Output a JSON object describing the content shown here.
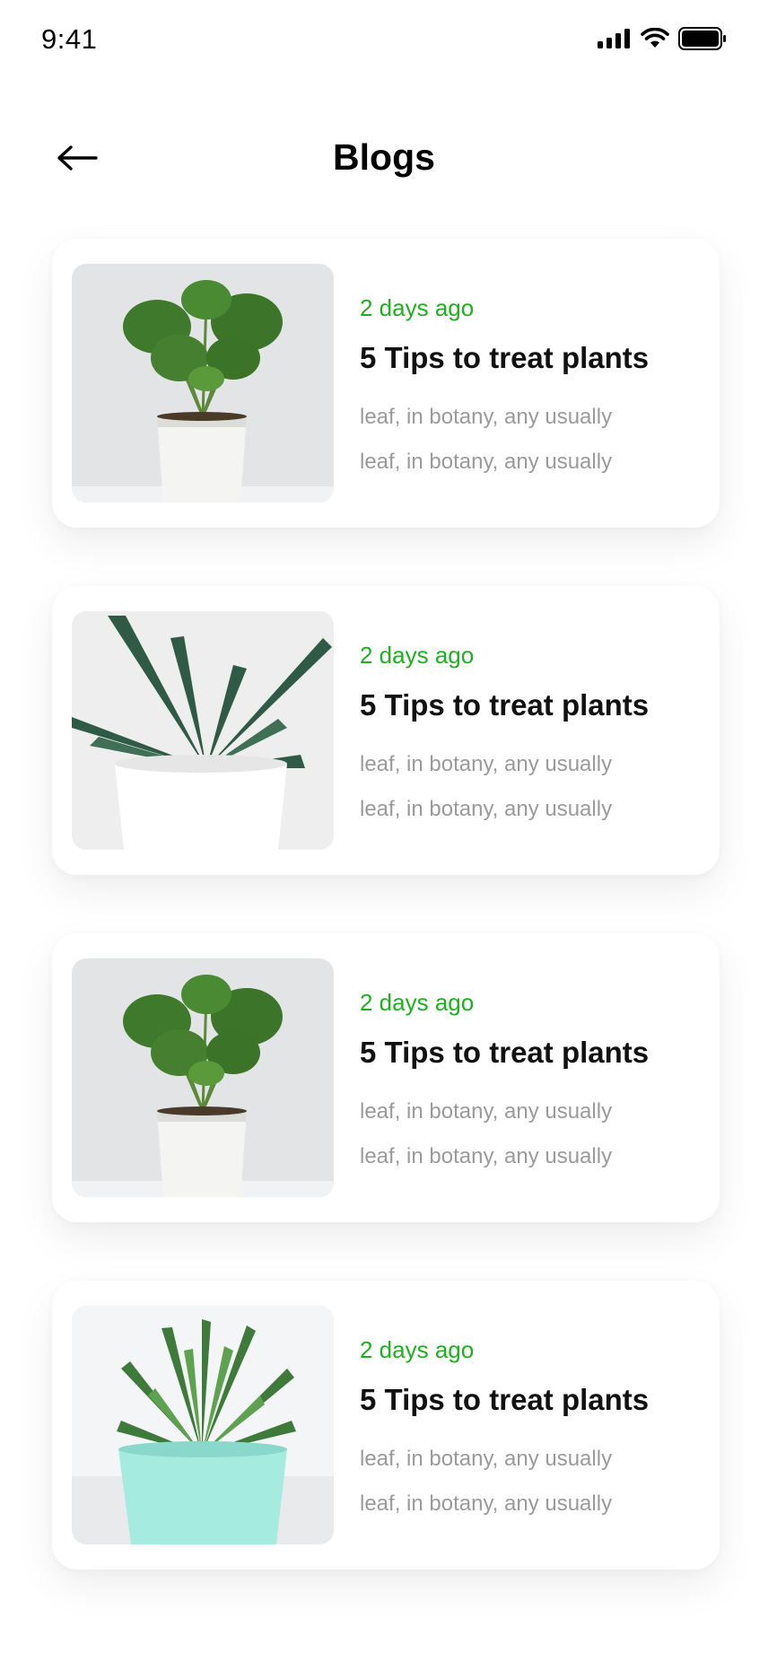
{
  "status_bar": {
    "time": "9:41"
  },
  "header": {
    "title": "Blogs"
  },
  "posts": [
    {
      "date": "2 days ago",
      "title": "5 Tips to treat plants",
      "excerpt_line1": "leaf, in botany, any usually",
      "excerpt_line2": "leaf, in botany, any usually"
    },
    {
      "date": "2 days ago",
      "title": "5 Tips to treat plants",
      "excerpt_line1": "leaf, in botany, any usually",
      "excerpt_line2": "leaf, in botany, any usually"
    },
    {
      "date": "2 days ago",
      "title": "5 Tips to treat plants",
      "excerpt_line1": "leaf, in botany, any usually",
      "excerpt_line2": "leaf, in botany, any usually"
    },
    {
      "date": "2 days ago",
      "title": "5 Tips to treat plants",
      "excerpt_line1": "leaf, in botany, any usually",
      "excerpt_line2": "leaf, in botany, any usually"
    }
  ],
  "icons": {
    "back": "arrow-left-icon",
    "signal": "cellular-signal-icon",
    "wifi": "wifi-icon",
    "battery": "battery-icon"
  },
  "colors": {
    "accent_green": "#1db11d",
    "excerpt_gray": "#9a9a9a",
    "title_black": "#111111"
  }
}
